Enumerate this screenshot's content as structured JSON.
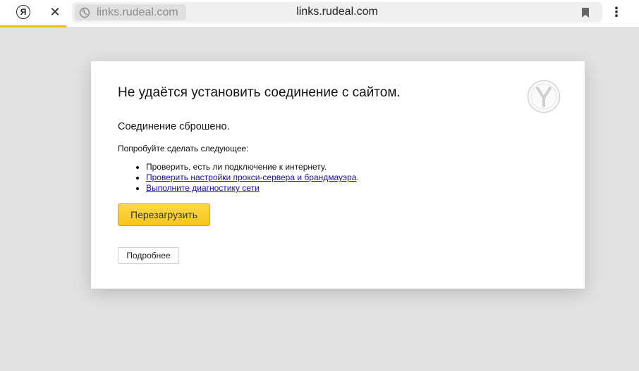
{
  "browser": {
    "logo_glyph": "Я",
    "close_glyph": "✕",
    "origin_chip_text": "links.rudeal.com",
    "address_text": "links.rudeal.com",
    "menu_glyph": "⋮"
  },
  "error_page": {
    "title": "Не удаётся установить соединение с сайтом.",
    "subtitle": "Соединение сброшено.",
    "try_text": "Попробуйте сделать следующее:",
    "suggestions": [
      "Проверить, есть ли подключение к интернету.",
      "Проверить настройки прокси-сервера и брандмауэра",
      "Выполните диагностику сети"
    ],
    "suggestion_suffix": ".",
    "reload_label": "Перезагрузить",
    "details_label": "Подробнее"
  },
  "colors": {
    "page_background": "#e2e2e2",
    "accent_yellow": "#f6c516",
    "link_blue": "#1a0dab",
    "progress_bar": "#f2c200"
  }
}
